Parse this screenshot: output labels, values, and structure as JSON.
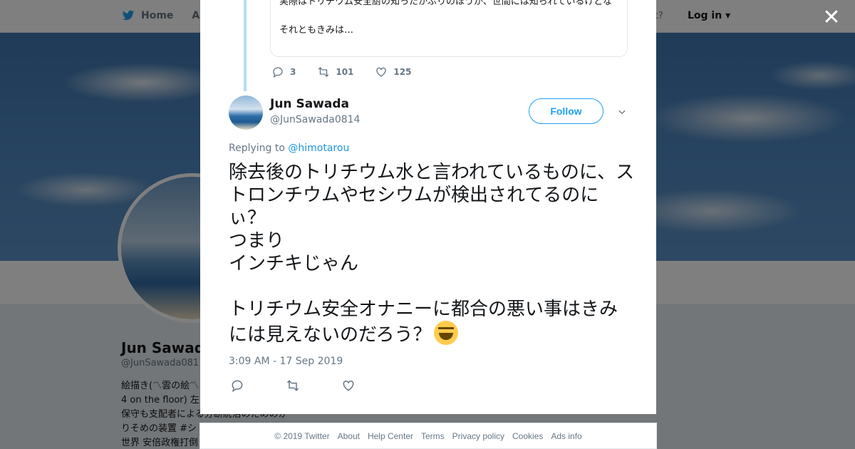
{
  "topbar": {
    "home_label": "Home",
    "about_label": "Abo",
    "account_text": "ccount?",
    "login_label": "Log in"
  },
  "profile": {
    "name": "Jun Sawada",
    "handle": "@JunSawada081",
    "bio_lines": [
      "絵描き(〽雲の絵〽",
      "4 on the floor) 左",
      "保守も支配者による分断統治のためのか",
      "りそめの装置 #シ",
      "世界 安倍政権打倒"
    ]
  },
  "parent_tweet": {
    "text_top": "実際はトリチウム安全厨の知ったかぶりのほうが、世間には知られているけどな",
    "text_bottom": "それともきみは…",
    "reply_count": "3",
    "retweet_count": "101",
    "like_count": "125"
  },
  "tweet": {
    "author_name": "Jun Sawada",
    "author_handle": "@JunSawada0814",
    "follow_label": "Follow",
    "replying_prefix": "Replying to",
    "replying_to": "@himotarou",
    "text": "除去後のトリチウム水と言われているものに、ストロンチウムやセシウムが検出されてるのにぃ？\nつまり\nインチキじゃん\n\nトリチウム安全オナニーに都合の悪い事はきみには見えないのだろう？",
    "emoji": "grinning-squinting-face",
    "timestamp": "3:09 AM - 17 Sep 2019"
  },
  "footer": {
    "copyright": "© 2019 Twitter",
    "about": "About",
    "help": "Help Center",
    "terms": "Terms",
    "privacy": "Privacy policy",
    "cookies": "Cookies",
    "ads": "Ads info"
  },
  "colors": {
    "accent": "#1da1f2",
    "text": "#14171a",
    "muted": "#657786",
    "thread_line": "#b3dcf5"
  },
  "icons": [
    "twitter-bird-icon",
    "close-icon",
    "reply-icon",
    "retweet-icon",
    "like-icon",
    "chevron-down-icon"
  ]
}
